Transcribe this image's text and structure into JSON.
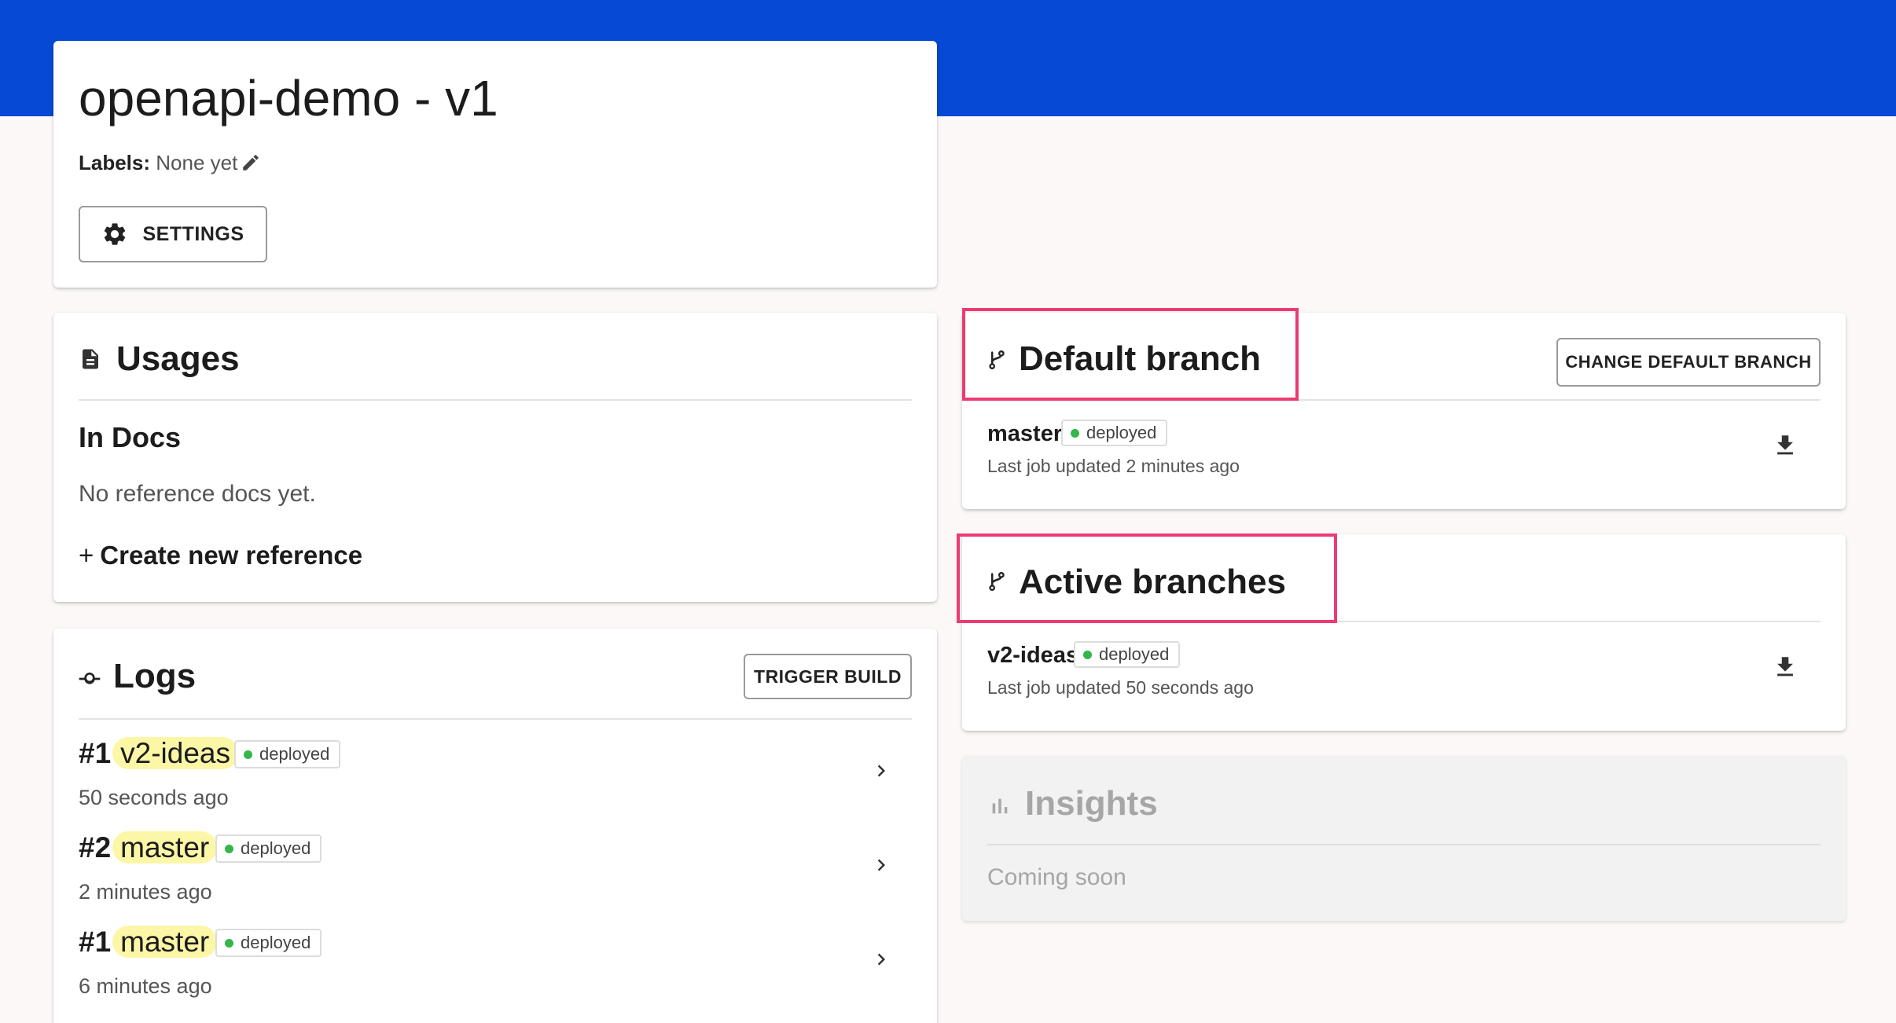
{
  "header": {
    "title": "openapi-demo - v1",
    "labels_key": "Labels:",
    "labels_value": "None yet",
    "settings_label": "SETTINGS"
  },
  "usages": {
    "title": "Usages",
    "section_title": "In Docs",
    "empty_text": "No reference docs yet.",
    "create_label": "Create new reference"
  },
  "logs": {
    "title": "Logs",
    "trigger_label": "TRIGGER BUILD",
    "items": [
      {
        "number": "#1",
        "branch": "v2-ideas",
        "status": "deployed",
        "time": "50 seconds ago"
      },
      {
        "number": "#2",
        "branch": "master",
        "status": "deployed",
        "time": "2 minutes ago"
      },
      {
        "number": "#1",
        "branch": "master",
        "status": "deployed",
        "time": "6 minutes ago"
      }
    ]
  },
  "default_branch": {
    "title": "Default branch",
    "change_label": "CHANGE DEFAULT BRANCH",
    "branch": "master",
    "status": "deployed",
    "updated": "Last job updated 2 minutes ago"
  },
  "active_branches": {
    "title": "Active branches",
    "branch": "v2-ideas",
    "status": "deployed",
    "updated": "Last job updated 50 seconds ago"
  },
  "insights": {
    "title": "Insights",
    "text": "Coming soon"
  },
  "colors": {
    "brand_blue": "#0549d4",
    "deployed_green": "#34b64a",
    "highlight_yellow": "#fcf7a6",
    "annotation_pink": "#ec3a73"
  }
}
